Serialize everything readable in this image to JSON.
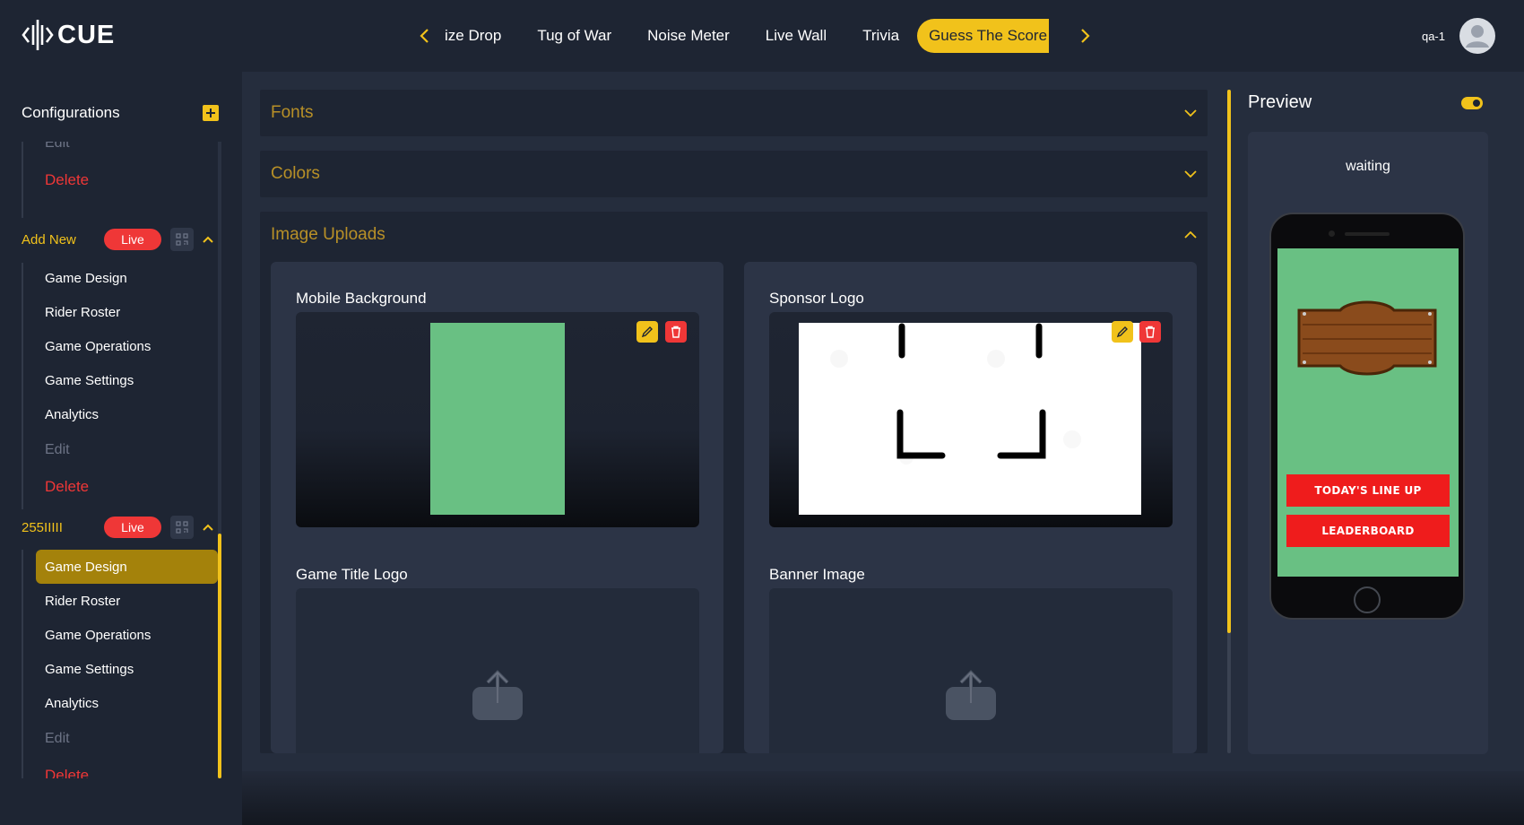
{
  "app": {
    "logo_text": "CUE",
    "user_name": "qa-1"
  },
  "colors": {
    "accent": "#f1c21b",
    "danger": "#ef3737",
    "background": "#1e2533",
    "panel": "#252d3d",
    "card": "#2c3446"
  },
  "nav": {
    "tabs": [
      {
        "label": "ize Drop",
        "active": false
      },
      {
        "label": "Tug of War",
        "active": false
      },
      {
        "label": "Noise Meter",
        "active": false
      },
      {
        "label": "Live Wall",
        "active": false
      },
      {
        "label": "Trivia",
        "active": false
      },
      {
        "label": "Guess The Score",
        "active": true
      }
    ]
  },
  "sidebar": {
    "title": "Configurations",
    "top_items": [
      {
        "label": "Edit",
        "kind": "muted"
      },
      {
        "label": "Delete",
        "kind": "danger"
      }
    ],
    "groups": [
      {
        "name": "Add New",
        "status": "Live",
        "items": [
          {
            "label": "Game Design"
          },
          {
            "label": "Rider Roster"
          },
          {
            "label": "Game Operations"
          },
          {
            "label": "Game Settings"
          },
          {
            "label": "Analytics"
          },
          {
            "label": "Edit",
            "kind": "muted"
          },
          {
            "label": "Delete",
            "kind": "danger"
          }
        ]
      },
      {
        "name": "255IIIII",
        "status": "Live",
        "items": [
          {
            "label": "Game Design",
            "active": true
          },
          {
            "label": "Rider Roster"
          },
          {
            "label": "Game Operations"
          },
          {
            "label": "Game Settings"
          },
          {
            "label": "Analytics"
          },
          {
            "label": "Edit",
            "kind": "muted"
          },
          {
            "label": "Delete",
            "kind": "danger"
          }
        ]
      }
    ]
  },
  "sections": {
    "fonts": "Fonts",
    "colors": "Colors",
    "images": "Image Uploads"
  },
  "uploads": {
    "mobile_background": "Mobile Background",
    "sponsor_logo": "Sponsor Logo",
    "game_title_logo": "Game Title Logo",
    "banner_image": "Banner Image"
  },
  "preview": {
    "title": "Preview",
    "status": "waiting",
    "buttons": [
      "TODAY'S LINE UP",
      "LEADERBOARD"
    ]
  }
}
